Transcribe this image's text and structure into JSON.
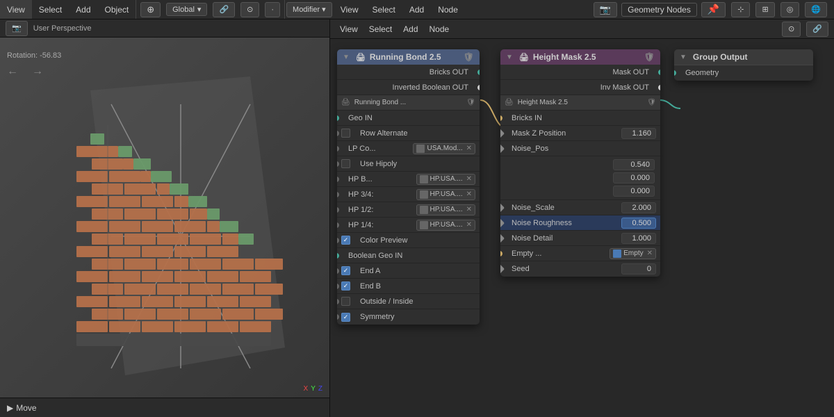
{
  "topbar": {
    "left_menus": [
      "View",
      "Select",
      "Add",
      "Object"
    ],
    "transform_mode": "Global",
    "right_section_left": [
      "Modifier",
      "View",
      "Select",
      "Add",
      "Node"
    ],
    "geo_nodes_label": "Geometry Nodes",
    "move_label": "Move"
  },
  "viewport": {
    "rotation_text": "Rotation: -56.83"
  },
  "running_bond_node": {
    "title": "Running Bond 2.5",
    "outputs": [
      {
        "label": "Bricks OUT"
      },
      {
        "label": "Inverted Boolean OUT"
      }
    ],
    "sub_label": "Running Bond ...",
    "inputs": [
      {
        "label": "Geo IN",
        "socket": "green"
      },
      {
        "label": "Row Alternate",
        "type": "checkbox",
        "checked": false
      },
      {
        "label": "LP Co...",
        "texture": "USA.Mod..."
      },
      {
        "label": "Use Hipoly",
        "type": "checkbox",
        "checked": false
      },
      {
        "label": "HP B...",
        "texture": "HP.USA...."
      },
      {
        "label": "HP 3/4:",
        "texture": "HP.USA...."
      },
      {
        "label": "HP 1/2:",
        "texture": "HP.USA...."
      },
      {
        "label": "HP 1/4:",
        "texture": "HP.USA...."
      },
      {
        "label": "Color Preview",
        "type": "checkbox",
        "checked": true
      },
      {
        "label": "Boolean Geo IN",
        "socket": "green"
      },
      {
        "label": "End A",
        "type": "checkbox",
        "checked": true
      },
      {
        "label": "End B",
        "type": "checkbox",
        "checked": true
      },
      {
        "label": "Outside / Inside",
        "type": "checkbox",
        "checked": false
      },
      {
        "label": "Symmetry",
        "type": "checkbox",
        "checked": true
      }
    ]
  },
  "height_mask_node": {
    "title": "Height Mask 2.5",
    "outputs": [
      {
        "label": "Mask OUT"
      },
      {
        "label": "Inv Mask OUT"
      }
    ],
    "sub_label": "Height Mask 2.5",
    "inputs": [
      {
        "label": "Bricks IN",
        "socket": "yellow"
      },
      {
        "label": "Mask Z Position",
        "value": "1.160",
        "socket": "diamond"
      },
      {
        "label": "Noise_Pos",
        "socket": "diamond"
      },
      {
        "value1": "0.540",
        "value2": "0.000",
        "value3": "0.000"
      },
      {
        "label": "Noise_Scale",
        "value": "2.000",
        "socket": "diamond"
      },
      {
        "label": "Noise Roughness",
        "value": "0.500",
        "socket": "diamond",
        "highlighted": true
      },
      {
        "label": "Noise Detail",
        "value": "1.000",
        "socket": "diamond"
      },
      {
        "label": "Empty ...",
        "texture": "Empty",
        "socket": "yellow"
      },
      {
        "label": "Seed",
        "value": "0",
        "socket": "diamond"
      }
    ]
  },
  "group_output_node": {
    "title": "Group Output",
    "inputs": [
      {
        "label": "Geometry",
        "socket": "green"
      }
    ]
  }
}
